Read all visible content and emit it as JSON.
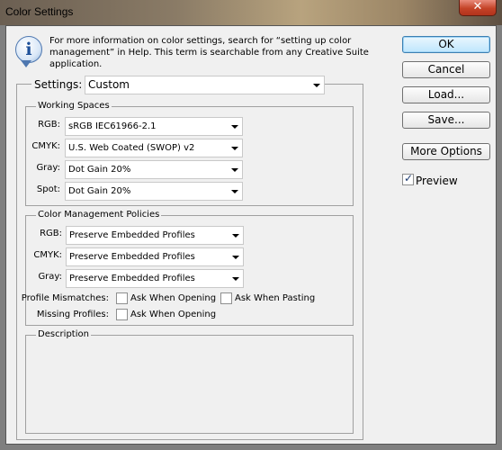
{
  "window": {
    "title": "Color Settings",
    "close_glyph": "✕"
  },
  "info": {
    "icon": "info-icon",
    "glyph": "i",
    "text": "For more information on color settings, search for “setting up color management” in Help. This term is searchable from any Creative Suite application."
  },
  "settings": {
    "label": "Settings:",
    "value": "Custom"
  },
  "working_spaces": {
    "title": "Working Spaces",
    "fields": [
      {
        "label": "RGB:",
        "value": "sRGB IEC61966-2.1"
      },
      {
        "label": "CMYK:",
        "value": "U.S. Web Coated (SWOP) v2"
      },
      {
        "label": "Gray:",
        "value": "Dot Gain 20%"
      },
      {
        "label": "Spot:",
        "value": "Dot Gain 20%"
      }
    ]
  },
  "policies": {
    "title": "Color Management Policies",
    "fields": [
      {
        "label": "RGB:",
        "value": "Preserve Embedded Profiles"
      },
      {
        "label": "CMYK:",
        "value": "Preserve Embedded Profiles"
      },
      {
        "label": "Gray:",
        "value": "Preserve Embedded Profiles"
      }
    ],
    "profile_mismatches": {
      "label": "Profile Mismatches:",
      "ask_when_opening": {
        "label": "Ask When Opening",
        "checked": false
      },
      "ask_when_pasting": {
        "label": "Ask When Pasting",
        "checked": false
      }
    },
    "missing_profiles": {
      "label": "Missing Profiles:",
      "ask_when_opening": {
        "label": "Ask When Opening",
        "checked": false
      }
    }
  },
  "description": {
    "title": "Description",
    "text": ""
  },
  "buttons": {
    "ok": "OK",
    "cancel": "Cancel",
    "load": "Load...",
    "save": "Save...",
    "more_options": "More Options"
  },
  "preview": {
    "label": "Preview",
    "checked": true,
    "check_glyph": "✓"
  },
  "colors": {
    "dialog_bg": "#f0f0f0",
    "close_button": "#c44328",
    "primary_button_border": "#3c7fb1"
  }
}
